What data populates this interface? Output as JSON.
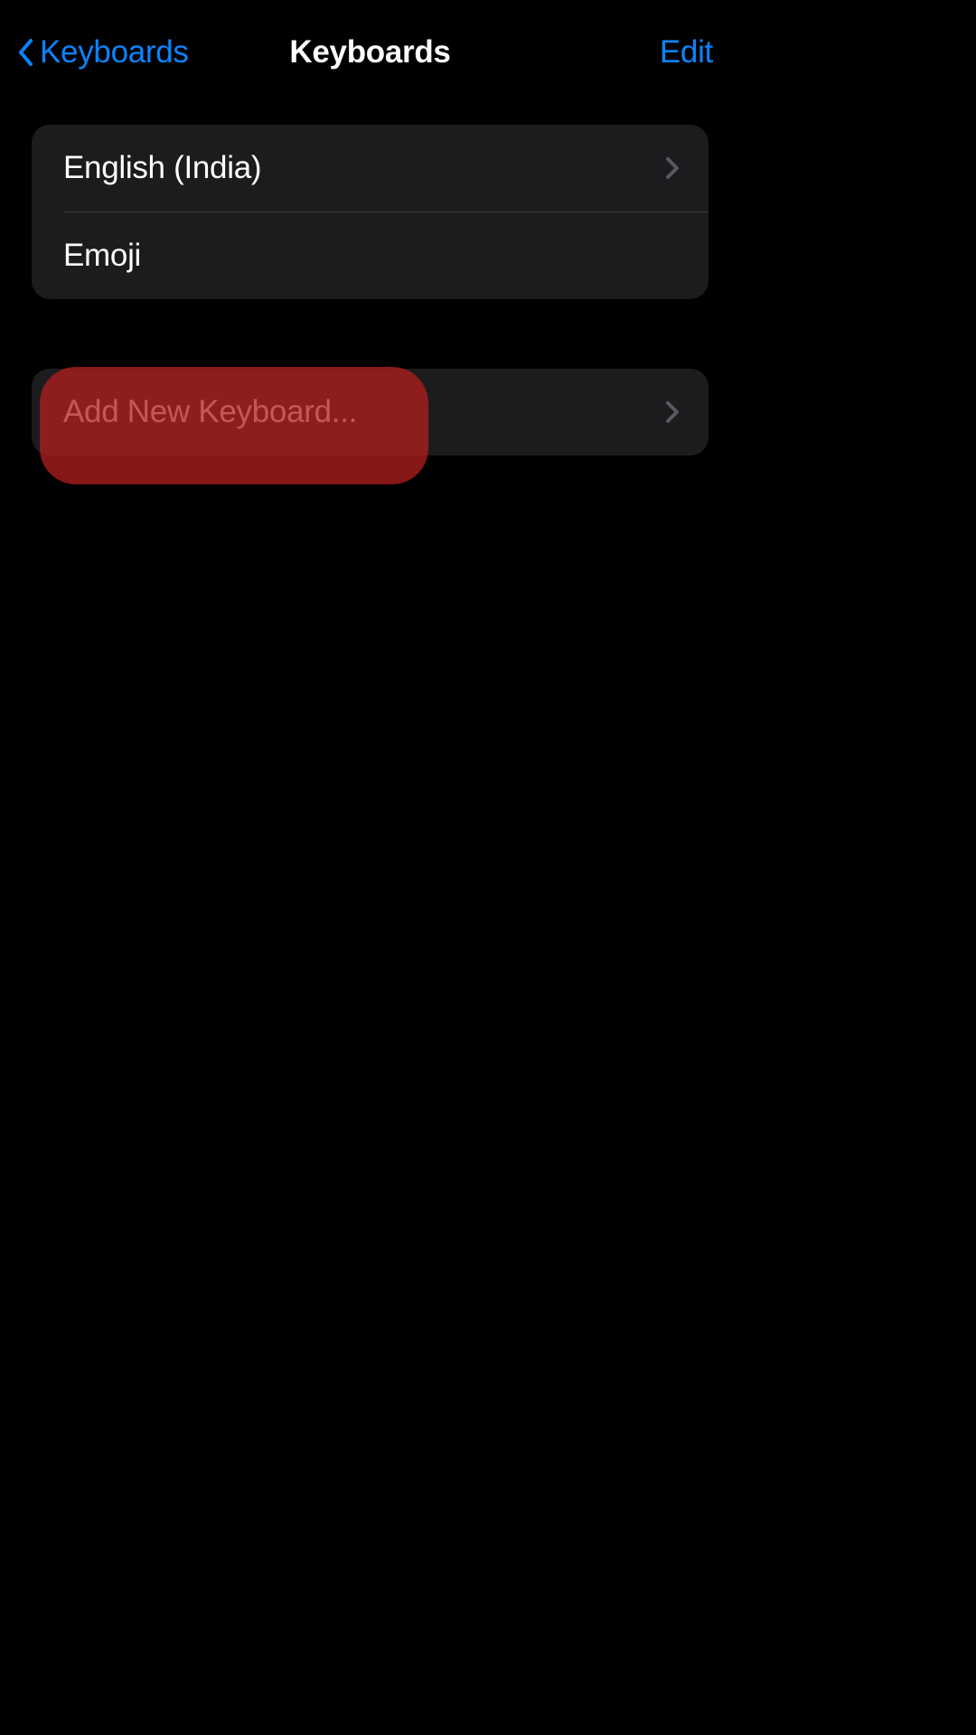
{
  "nav": {
    "back_label": "Keyboards",
    "title": "Keyboards",
    "edit_label": "Edit"
  },
  "keyboards_group": {
    "items": [
      {
        "label": "English (India)"
      },
      {
        "label": "Emoji"
      }
    ]
  },
  "add_group": {
    "label": "Add New Keyboard..."
  }
}
